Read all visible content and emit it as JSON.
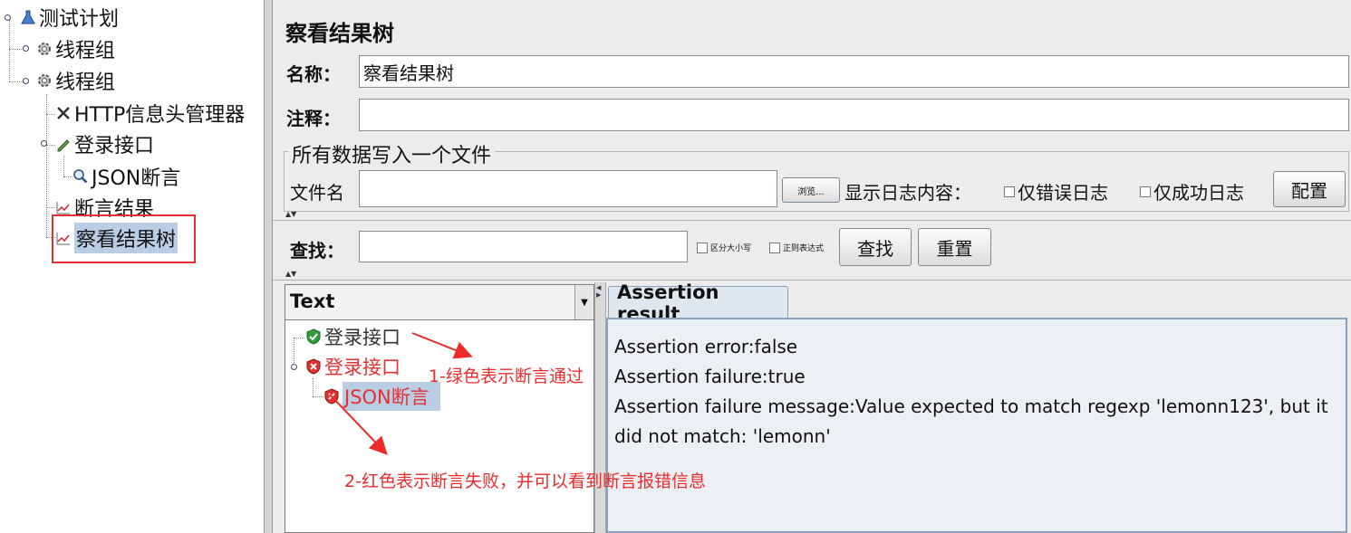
{
  "tree": {
    "root": "测试计划",
    "thread_group_1": "线程组",
    "thread_group_2": "线程组",
    "header_manager": "HTTP信息头管理器",
    "login_api": "登录接口",
    "json_assertion": "JSON断言",
    "assertion_results": "断言结果",
    "view_results_tree": "察看结果树"
  },
  "panel": {
    "title": "察看结果树",
    "name_label": "名称：",
    "name_value": "察看结果树",
    "comment_label": "注释：",
    "comment_value": "",
    "file_section_title": "所有数据写入一个文件",
    "filename_label": "文件名",
    "filename_value": "",
    "browse_label": "浏览...",
    "log_content_label": "显示日志内容：",
    "errors_only_label": "仅错误日志",
    "success_only_label": "仅成功日志",
    "config_label": "配置"
  },
  "search": {
    "label": "查找：",
    "value": "",
    "case_sensitive_label": "区分大小写",
    "regex_label": "正则表达式",
    "find_label": "查找",
    "reset_label": "重置"
  },
  "results": {
    "renderer": "Text",
    "items": [
      {
        "label": "登录接口",
        "status": "pass",
        "status_color": "#2e9e3a"
      },
      {
        "label": "登录接口",
        "status": "fail",
        "status_color": "#e53030"
      },
      {
        "label": "JSON断言",
        "status": "fail",
        "status_color": "#e53030"
      }
    ],
    "tab_label": "Assertion result",
    "assertion_lines": [
      "Assertion error:false",
      "Assertion failure:true",
      "Assertion failure message:Value expected to match regexp 'lemonn123', but it",
      "did not match: 'lemonn'"
    ]
  },
  "annotations": {
    "green_note": "1-绿色表示断言通过",
    "red_note": "2-红色表示断言失败，并可以看到断言报错信息",
    "annotation_color": "#ee2b2b",
    "highlight_color": "#e53030"
  }
}
